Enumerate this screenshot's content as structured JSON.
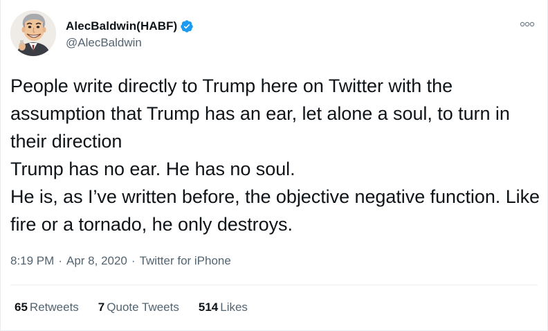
{
  "author": {
    "display_name": "AlecBaldwin(HABF)",
    "handle": "@AlecBaldwin",
    "verified": true,
    "avatar": "caricature-avatar"
  },
  "tweet": {
    "text": "People write directly to Trump here on Twitter with the assumption that Trump has an ear, let alone a soul, to turn in their direction\nTrump has no ear. He has no soul.\nHe is, as I’ve written before, the objective negative function. Like fire or a tornado, he only destroys."
  },
  "meta": {
    "time": "8:19 PM",
    "separator": "·",
    "date": "Apr 8, 2020",
    "source": "Twitter for iPhone"
  },
  "stats": {
    "retweets": {
      "count": "65",
      "label": "Retweets"
    },
    "quote_tweets": {
      "count": "7",
      "label": "Quote Tweets"
    },
    "likes": {
      "count": "514",
      "label": "Likes"
    }
  },
  "colors": {
    "text": "#0f1419",
    "secondary": "#536471",
    "verified": "#1d9bf0",
    "divider": "#eceff1"
  },
  "icons": {
    "more": "more-options-icon",
    "verified": "verified-badge-icon"
  }
}
